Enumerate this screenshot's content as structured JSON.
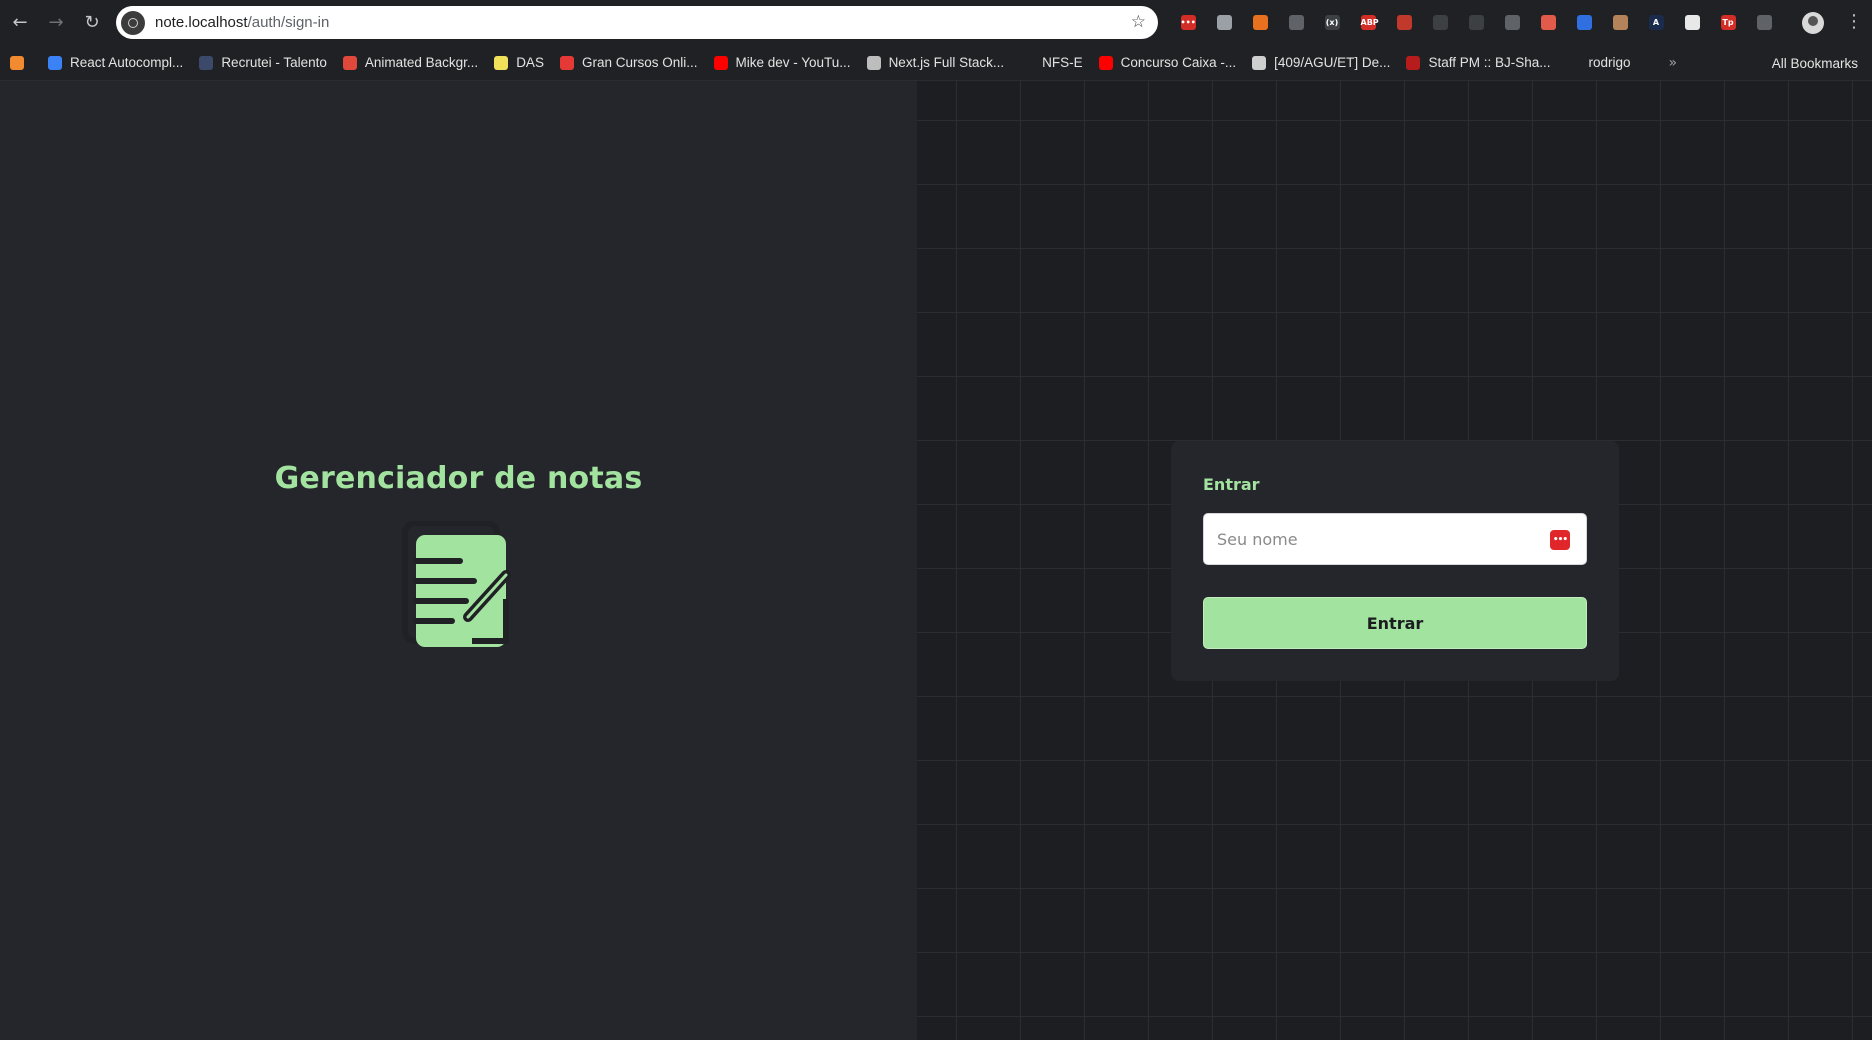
{
  "browser": {
    "url_host": "note.localhost",
    "url_path": "/auth/sign-in",
    "nav": {
      "back_icon": "←",
      "forward_icon": "→",
      "reload_icon": "↻"
    },
    "star_icon": "☆",
    "extensions": [
      {
        "name": "lastpass-ext-icon",
        "label": "•••",
        "color": "#d32d27"
      },
      {
        "name": "bitwarden-ext-icon",
        "label": "",
        "color": "#9aa0a6"
      },
      {
        "name": "react-devtools-ext-icon",
        "label": "",
        "color": "#e8711f"
      },
      {
        "name": "ext-circle-icon",
        "label": "",
        "color": "#5f6368"
      },
      {
        "name": "ext-brackets-icon",
        "label": "(x)",
        "color": "#3c4043"
      },
      {
        "name": "adblock-plus-ext-icon",
        "label": "ABP",
        "color": "#d32d27"
      },
      {
        "name": "ext-red-badge-icon",
        "label": "",
        "color": "#c0392b"
      },
      {
        "name": "ext-ring-icon",
        "label": "",
        "color": "#3c4043"
      },
      {
        "name": "ext-screen-icon",
        "label": "",
        "color": "#3c4043"
      },
      {
        "name": "ext-target-icon",
        "label": "",
        "color": "#5f6368"
      },
      {
        "name": "ext-pdf-icon",
        "label": "",
        "color": "#e25b4a"
      },
      {
        "name": "ext-blue-square-icon",
        "label": "",
        "color": "#2f6fe0"
      },
      {
        "name": "ext-owl-icon",
        "label": "",
        "color": "#b5835a"
      },
      {
        "name": "ext-a-circle-icon",
        "label": "A",
        "color": "#1a2b4c"
      },
      {
        "name": "ext-notes-icon",
        "label": "",
        "color": "#e8e8e8"
      },
      {
        "name": "ext-tp-icon",
        "label": "Tp",
        "color": "#d32d27"
      },
      {
        "name": "extensions-puzzle-icon",
        "label": "",
        "color": "#5f6368"
      }
    ],
    "menu_icon": "⋮",
    "bookmarks": [
      {
        "label": "",
        "color": "#f28b30"
      },
      {
        "label": "React Autocompl...",
        "color": "#3b82f6"
      },
      {
        "label": "Recrutei - Talento",
        "color": "#3b4a6b"
      },
      {
        "label": "Animated Backgr...",
        "color": "#e0483b"
      },
      {
        "label": "DAS",
        "color": "#f1e05a"
      },
      {
        "label": "Gran Cursos Onli...",
        "color": "#e53935"
      },
      {
        "label": "Mike dev - YouTu...",
        "color": "#ff0000"
      },
      {
        "label": "Next.js Full Stack...",
        "color": "#bdbdbd"
      },
      {
        "label": "NFS-E",
        "color": "#202124"
      },
      {
        "label": "Concurso Caixa -...",
        "color": "#ff0000"
      },
      {
        "label": "[409/AGU/ET] De...",
        "color": "#cfcfcf"
      },
      {
        "label": "Staff PM :: BJ-Sha...",
        "color": "#b71c1c"
      },
      {
        "label": "rodrigo",
        "color": "#202124"
      }
    ],
    "bookmarks_more": "»",
    "all_bookmarks": "All Bookmarks"
  },
  "hero": {
    "title": "Gerenciador de notas",
    "logo_icon": "note-edit-icon",
    "accent": "#a3e3a0"
  },
  "form": {
    "title": "Entrar",
    "name_input": {
      "placeholder": "Seu nome",
      "value": ""
    },
    "password_manager_icon": "•••",
    "submit_label": "Entrar"
  }
}
